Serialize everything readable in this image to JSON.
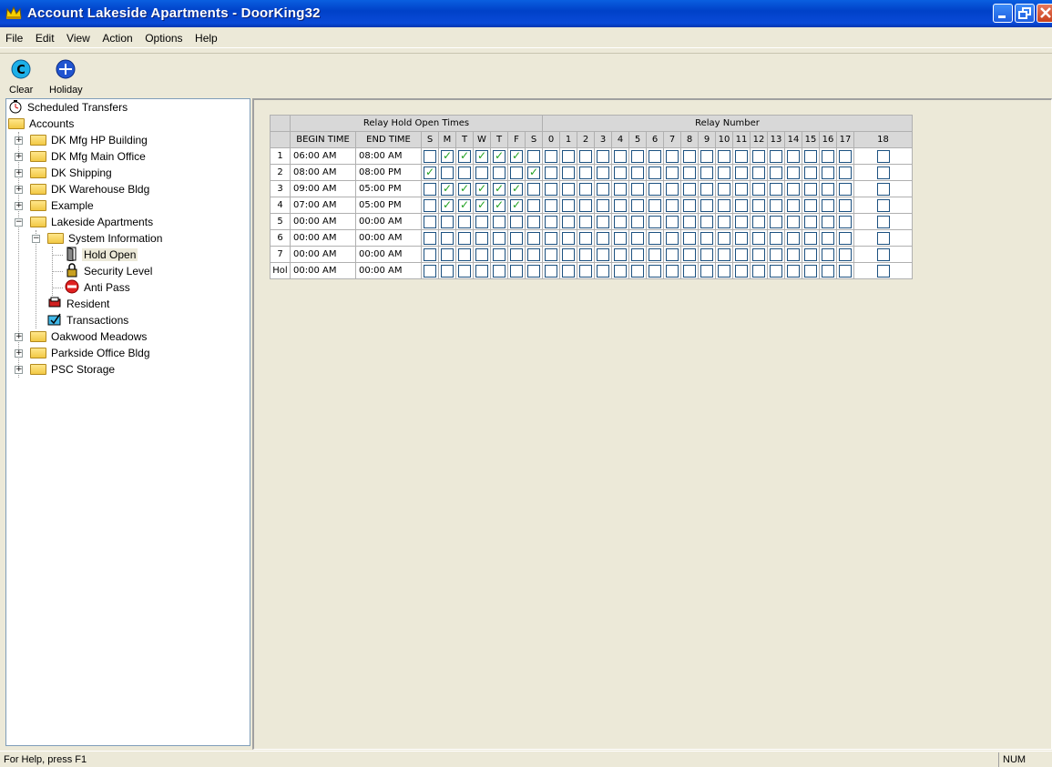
{
  "window": {
    "title": "Account Lakeside Apartments  - DoorKing32",
    "colors": {
      "titlebar": "#0a4ad8",
      "check": "#21a121"
    }
  },
  "menu": [
    "File",
    "Edit",
    "View",
    "Action",
    "Options",
    "Help"
  ],
  "toolbar": {
    "clear_label": "Clear",
    "holiday_label": "Holiday"
  },
  "tree": {
    "scheduled_transfers": "Scheduled Transfers",
    "accounts": "Accounts",
    "items": [
      "DK Mfg HP Building",
      "DK Mfg Main Office",
      "DK Shipping",
      "DK Warehouse Bldg",
      "Example",
      "Lakeside Apartments"
    ],
    "system_information": "System Information",
    "hold_open": "Hold Open",
    "security_level": "Security Level",
    "anti_pass": "Anti Pass",
    "resident": "Resident",
    "transactions": "Transactions",
    "items_after": [
      "Oakwood Meadows",
      "Parkside Office Bldg",
      "PSC Storage"
    ]
  },
  "grid": {
    "group_hold": "Relay Hold Open Times",
    "group_relay": "Relay Number",
    "col_begin": "BEGIN TIME",
    "col_end": "END TIME",
    "days": [
      "S",
      "M",
      "T",
      "W",
      "T",
      "F",
      "S"
    ],
    "relays": [
      "0",
      "1",
      "2",
      "3",
      "4",
      "5",
      "6",
      "7",
      "8",
      "9",
      "10",
      "11",
      "12",
      "13",
      "14",
      "15",
      "16",
      "17",
      "18"
    ],
    "rows": [
      {
        "id": "1",
        "begin": "06:00 AM",
        "end": "08:00 AM",
        "days": [
          0,
          1,
          1,
          1,
          1,
          1,
          0
        ]
      },
      {
        "id": "2",
        "begin": "08:00 AM",
        "end": "08:00 PM",
        "days": [
          1,
          0,
          0,
          0,
          0,
          0,
          1
        ]
      },
      {
        "id": "3",
        "begin": "09:00 AM",
        "end": "05:00 PM",
        "days": [
          0,
          1,
          1,
          1,
          1,
          1,
          0
        ]
      },
      {
        "id": "4",
        "begin": "07:00 AM",
        "end": "05:00 PM",
        "days": [
          0,
          1,
          1,
          1,
          1,
          1,
          0
        ]
      },
      {
        "id": "5",
        "begin": "00:00 AM",
        "end": "00:00 AM",
        "days": [
          0,
          0,
          0,
          0,
          0,
          0,
          0
        ]
      },
      {
        "id": "6",
        "begin": "00:00 AM",
        "end": "00:00 AM",
        "days": [
          0,
          0,
          0,
          0,
          0,
          0,
          0
        ]
      },
      {
        "id": "7",
        "begin": "00:00 AM",
        "end": "00:00 AM",
        "days": [
          0,
          0,
          0,
          0,
          0,
          0,
          0
        ]
      },
      {
        "id": "Hol",
        "begin": "00:00 AM",
        "end": "00:00 AM",
        "days": [
          0,
          0,
          0,
          0,
          0,
          0,
          0
        ]
      }
    ]
  },
  "status": {
    "help": "For Help, press F1",
    "num": "NUM"
  }
}
